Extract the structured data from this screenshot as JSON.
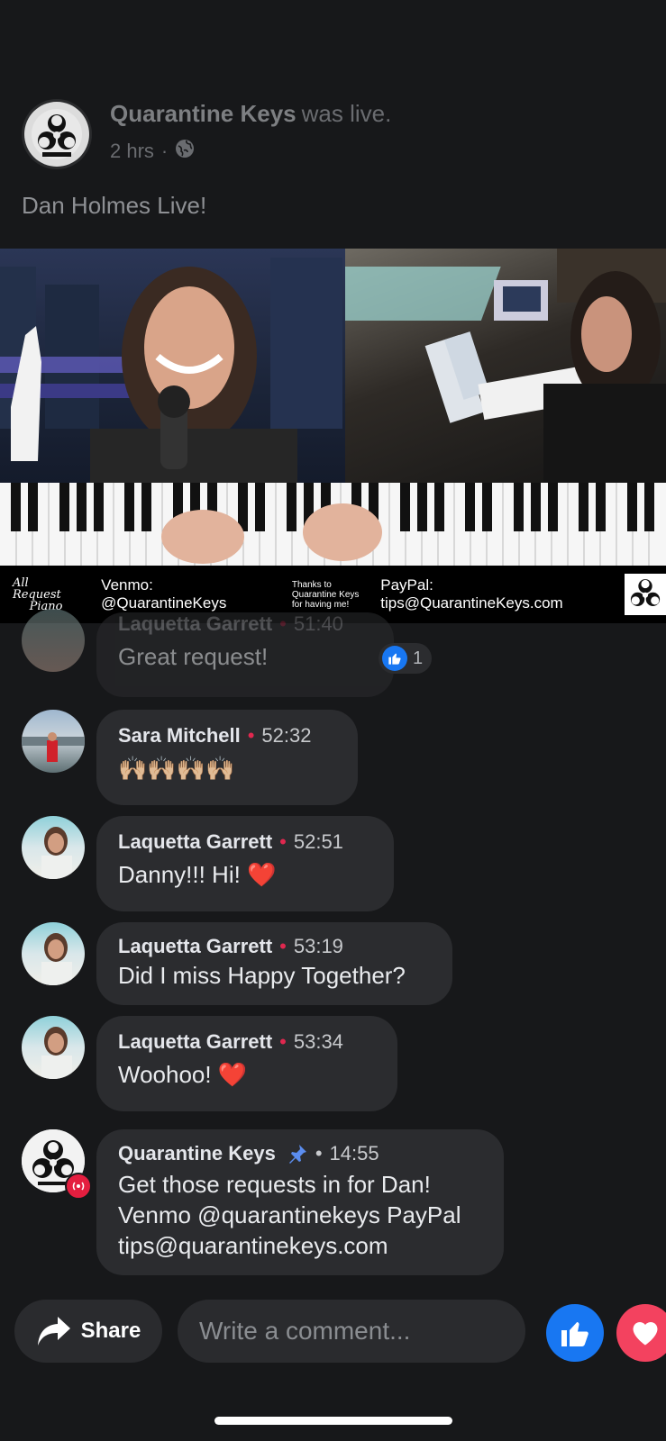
{
  "post": {
    "page_name": "Quarantine Keys",
    "status": "was live.",
    "time": "2 hrs",
    "separator": "·",
    "text": "Dan Holmes Live!"
  },
  "video": {
    "banner_venmo": "Venmo: @QuarantineKeys",
    "banner_thanks": "Thanks to Quarantine Keys for having me!",
    "banner_paypal": "PayPal: tips@QuarantineKeys.com",
    "logo_text_top": "All Request",
    "logo_text_bottom": "Piano"
  },
  "comments": [
    {
      "name": "Laquetta Garrett",
      "time": "51:40",
      "text": "Great request!",
      "reaction_count": "1"
    },
    {
      "name": "Sara Mitchell",
      "time": "52:32",
      "text": "🙌🏼🙌🏼🙌🏼🙌🏼"
    },
    {
      "name": "Laquetta Garrett",
      "time": "52:51",
      "text": "Danny!!! Hi! ❤️"
    },
    {
      "name": "Laquetta Garrett",
      "time": "53:19",
      "text": "Did I miss Happy Together?"
    },
    {
      "name": "Laquetta Garrett",
      "time": "53:34",
      "text": "Woohoo! ❤️"
    },
    {
      "name": "Quarantine Keys",
      "time": "14:55",
      "lines": [
        "Get those requests in for Dan!",
        "Venmo @quarantinekeys PayPal",
        "tips@quarantinekeys.com"
      ]
    }
  ],
  "dot": "•",
  "bottom_bar": {
    "share_label": "Share",
    "comment_placeholder": "Write a comment..."
  },
  "colors": {
    "background": "#17181a",
    "bubble": "#2b2c2f",
    "like_blue": "#1877f2",
    "love_red": "#f3425f",
    "time_dot": "#e0284f",
    "pin_blue": "#5b8def"
  },
  "icons": [
    "biohazard-icon",
    "globe-icon",
    "pin-icon",
    "like-icon",
    "love-icon",
    "share-arrow-icon",
    "live-badge-icon"
  ]
}
